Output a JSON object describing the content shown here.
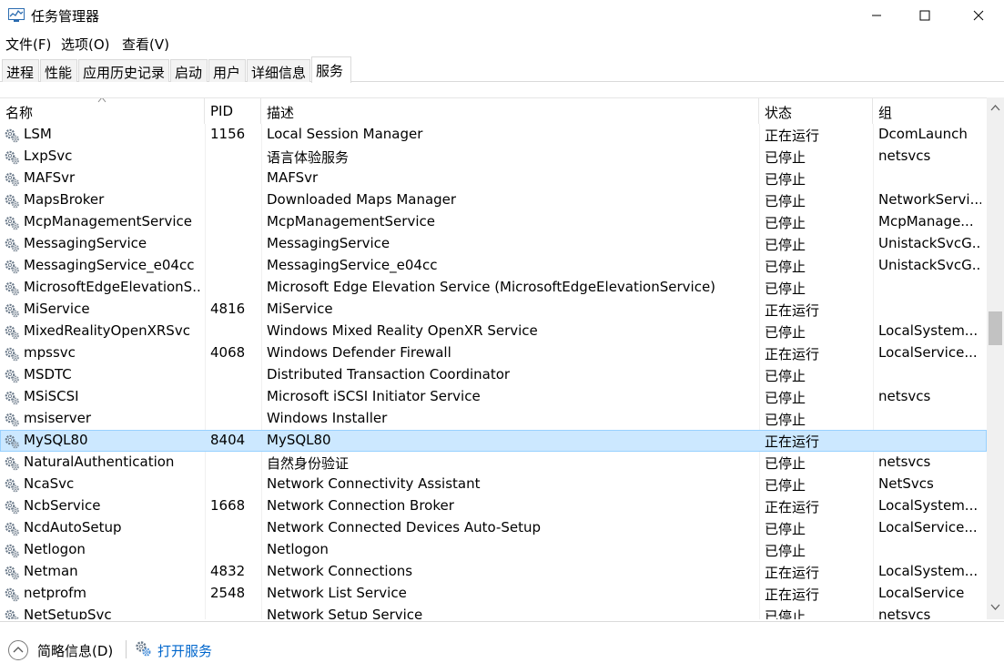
{
  "window": {
    "title": "任务管理器",
    "minimize_icon": "minimize-icon",
    "maximize_icon": "maximize-icon",
    "close_icon": "close-icon"
  },
  "menu": [
    "文件(F)",
    "选项(O)",
    "查看(V)"
  ],
  "tabs": [
    {
      "label": "进程",
      "active": false
    },
    {
      "label": "性能",
      "active": false
    },
    {
      "label": "应用历史记录",
      "active": false
    },
    {
      "label": "启动",
      "active": false
    },
    {
      "label": "用户",
      "active": false
    },
    {
      "label": "详细信息",
      "active": false
    },
    {
      "label": "服务",
      "active": true
    }
  ],
  "columns": {
    "name": "名称",
    "pid": "PID",
    "desc": "描述",
    "status": "状态",
    "group": "组"
  },
  "rows": [
    {
      "name": "LSM",
      "pid": "1156",
      "desc": "Local Session Manager",
      "status": "正在运行",
      "group": "DcomLaunch"
    },
    {
      "name": "LxpSvc",
      "pid": "",
      "desc": "语言体验服务",
      "status": "已停止",
      "group": "netsvcs"
    },
    {
      "name": "MAFSvr",
      "pid": "",
      "desc": "MAFSvr",
      "status": "已停止",
      "group": ""
    },
    {
      "name": "MapsBroker",
      "pid": "",
      "desc": "Downloaded Maps Manager",
      "status": "已停止",
      "group": "NetworkServi..."
    },
    {
      "name": "McpManagementService",
      "pid": "",
      "desc": "McpManagementService",
      "status": "已停止",
      "group": "McpManage..."
    },
    {
      "name": "MessagingService",
      "pid": "",
      "desc": "MessagingService",
      "status": "已停止",
      "group": "UnistackSvcG..."
    },
    {
      "name": "MessagingService_e04cc",
      "pid": "",
      "desc": "MessagingService_e04cc",
      "status": "已停止",
      "group": "UnistackSvcG..."
    },
    {
      "name": "MicrosoftEdgeElevationS...",
      "pid": "",
      "desc": "Microsoft Edge Elevation Service (MicrosoftEdgeElevationService)",
      "status": "已停止",
      "group": ""
    },
    {
      "name": "MiService",
      "pid": "4816",
      "desc": "MiService",
      "status": "正在运行",
      "group": ""
    },
    {
      "name": "MixedRealityOpenXRSvc",
      "pid": "",
      "desc": "Windows Mixed Reality OpenXR Service",
      "status": "已停止",
      "group": "LocalSystem..."
    },
    {
      "name": "mpssvc",
      "pid": "4068",
      "desc": "Windows Defender Firewall",
      "status": "正在运行",
      "group": "LocalService..."
    },
    {
      "name": "MSDTC",
      "pid": "",
      "desc": "Distributed Transaction Coordinator",
      "status": "已停止",
      "group": ""
    },
    {
      "name": "MSiSCSI",
      "pid": "",
      "desc": "Microsoft iSCSI Initiator Service",
      "status": "已停止",
      "group": "netsvcs"
    },
    {
      "name": "msiserver",
      "pid": "",
      "desc": "Windows Installer",
      "status": "已停止",
      "group": ""
    },
    {
      "name": "MySQL80",
      "pid": "8404",
      "desc": "MySQL80",
      "status": "正在运行",
      "group": "",
      "selected": true
    },
    {
      "name": "NaturalAuthentication",
      "pid": "",
      "desc": "自然身份验证",
      "status": "已停止",
      "group": "netsvcs"
    },
    {
      "name": "NcaSvc",
      "pid": "",
      "desc": "Network Connectivity Assistant",
      "status": "已停止",
      "group": "NetSvcs"
    },
    {
      "name": "NcbService",
      "pid": "1668",
      "desc": "Network Connection Broker",
      "status": "正在运行",
      "group": "LocalSystem..."
    },
    {
      "name": "NcdAutoSetup",
      "pid": "",
      "desc": "Network Connected Devices Auto-Setup",
      "status": "已停止",
      "group": "LocalService..."
    },
    {
      "name": "Netlogon",
      "pid": "",
      "desc": "Netlogon",
      "status": "已停止",
      "group": ""
    },
    {
      "name": "Netman",
      "pid": "4832",
      "desc": "Network Connections",
      "status": "正在运行",
      "group": "LocalSystem..."
    },
    {
      "name": "netprofm",
      "pid": "2548",
      "desc": "Network List Service",
      "status": "正在运行",
      "group": "LocalService"
    },
    {
      "name": "NetSetupSvc",
      "pid": "",
      "desc": "Network Setup Service",
      "status": "已停止",
      "group": "netsvcs"
    }
  ],
  "footer": {
    "fewer_details": "简略信息(D)",
    "open_services": "打开服务"
  },
  "colors": {
    "selected_row": "#cce8ff",
    "selected_border": "#99d1ff",
    "link": "#0066cc"
  }
}
